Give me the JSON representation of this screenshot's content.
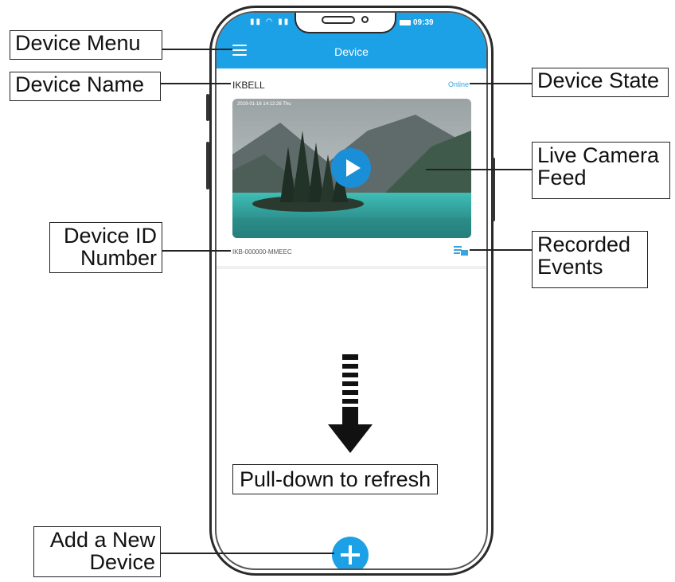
{
  "app": {
    "header_title": "Device",
    "status_bar_time": "09:39",
    "device_name": "IKBELL",
    "device_state": "Online",
    "device_id": "IKB-000000-MMEEC",
    "feed_timestamp": "2019-01-16  14:12:26 Thu"
  },
  "labels": {
    "device_menu": "Device Menu",
    "device_name": "Device Name",
    "device_state": "Device State",
    "live_feed_line1": "Live Camera",
    "live_feed_line2": "Feed",
    "device_id_line1": "Device ID",
    "device_id_line2": "Number",
    "recorded_line1": "Recorded",
    "recorded_line2": "Events",
    "pull_down": "Pull-down to refresh",
    "add_device_line1": "Add a New",
    "add_device_line2": "Device"
  },
  "icons": {
    "menu": "hamburger-icon",
    "play": "play-icon",
    "recorded": "recorded-events-icon",
    "add": "plus-icon",
    "arrow": "down-arrow-icon"
  },
  "colors": {
    "accent": "#1da1e6",
    "state_text": "#3aa4e0",
    "play_button": "#1a8fd8"
  }
}
